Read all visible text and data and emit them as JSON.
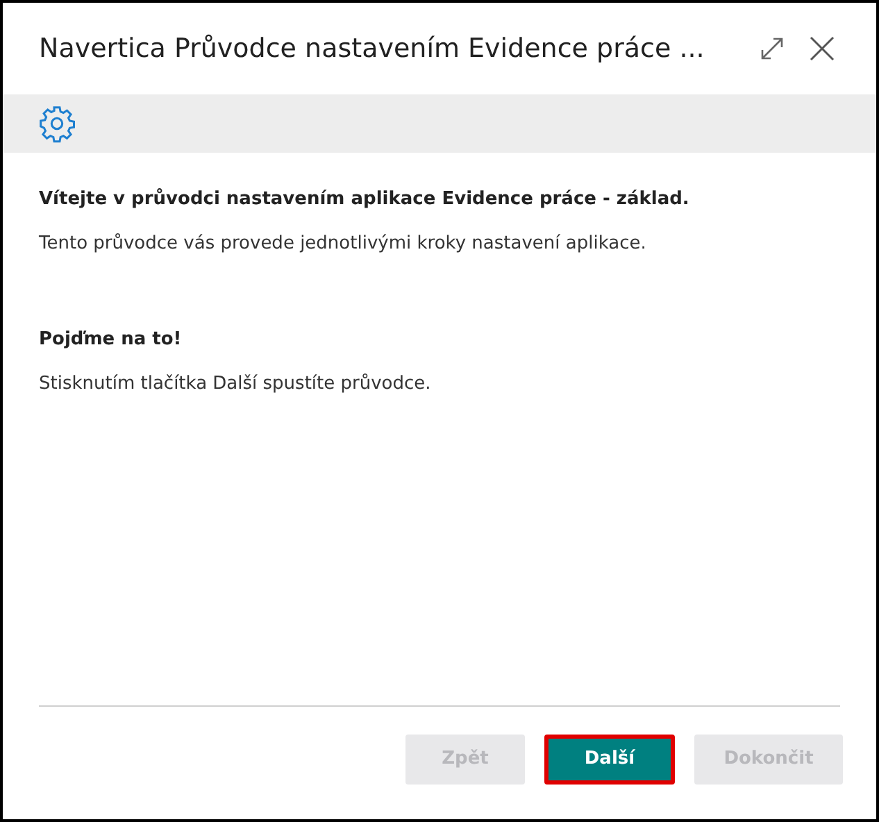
{
  "window": {
    "title": "Navertica Průvodce nastavením Evidence práce ..."
  },
  "sections": [
    {
      "heading": "Vítejte v průvodci nastavením aplikace Evidence práce - základ.",
      "text": "Tento průvodce vás provede jednotlivými kroky nastavení aplikace."
    },
    {
      "heading": "Pojďme na to!",
      "text": "Stisknutím tlačítka Další spustíte průvodce."
    }
  ],
  "buttons": [
    {
      "label": "Zpět",
      "disabled": true,
      "primary": false,
      "highlighted": false
    },
    {
      "label": "Další",
      "disabled": false,
      "primary": true,
      "highlighted": true
    },
    {
      "label": "Dokončit",
      "disabled": true,
      "primary": false,
      "highlighted": false
    }
  ]
}
